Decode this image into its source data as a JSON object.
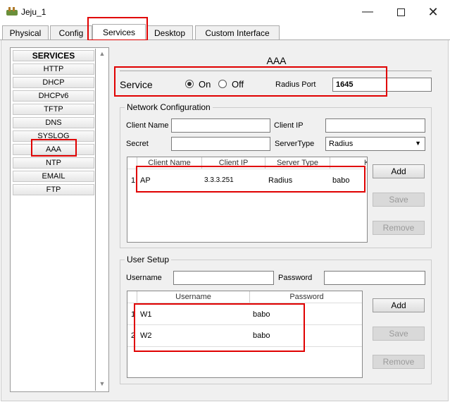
{
  "window": {
    "title": "Jeju_1"
  },
  "tabs": [
    "Physical",
    "Config",
    "Services",
    "Desktop",
    "Custom Interface"
  ],
  "sidebar": {
    "header": "SERVICES",
    "items": [
      "HTTP",
      "DHCP",
      "DHCPv6",
      "TFTP",
      "DNS",
      "SYSLOG",
      "AAA",
      "NTP",
      "EMAIL",
      "FTP"
    ]
  },
  "aaa": {
    "title": "AAA",
    "service_label": "Service",
    "on_label": "On",
    "off_label": "Off",
    "service_state": "On",
    "radius_port_label": "Radius Port",
    "radius_port_value": "1645"
  },
  "network_config": {
    "title": "Network Configuration",
    "client_name_label": "Client Name",
    "client_ip_label": "Client IP",
    "secret_label": "Secret",
    "server_type_label": "ServerType",
    "server_type_value": "Radius",
    "columns": [
      "Client Name",
      "Client IP",
      "Server Type",
      "Key"
    ],
    "rows": [
      {
        "num": "1",
        "client_name": "AP",
        "client_ip": "3.3.3.251",
        "server_type": "Radius",
        "key": "babo"
      }
    ],
    "add": "Add",
    "save": "Save",
    "remove": "Remove"
  },
  "user_setup": {
    "title": "User Setup",
    "username_label": "Username",
    "password_label": "Password",
    "columns": [
      "Username",
      "Password"
    ],
    "rows": [
      {
        "num": "1",
        "username": "W1",
        "password": "babo"
      },
      {
        "num": "2",
        "username": "W2",
        "password": "babo"
      }
    ],
    "add": "Add",
    "save": "Save",
    "remove": "Remove"
  }
}
